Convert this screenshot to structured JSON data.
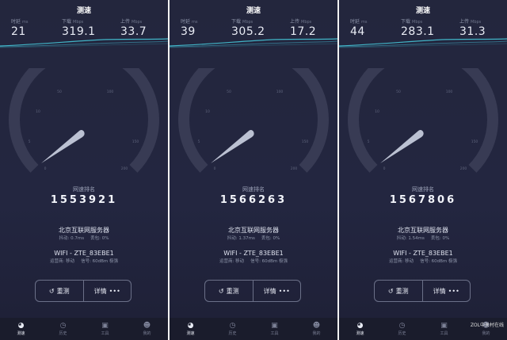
{
  "panels": [
    {
      "title": "测速",
      "metrics": [
        {
          "label": "时延",
          "unit": "ms",
          "value": "21"
        },
        {
          "label": "下载",
          "unit": "Mbps",
          "value": "319.1"
        },
        {
          "label": "上传",
          "unit": "Mbps",
          "value": "33.7"
        }
      ],
      "rank_label": "网速排名",
      "rank_value": "1553921",
      "server": "北京互联网服务器",
      "jitter": "抖动: 0.7ms",
      "loss": "丢包: 0%",
      "wifi": "WIFI - ZTE_83EBE1",
      "operator": "运营商: 移动",
      "signal": "信号: 60dBm 极强",
      "retest_label": "重测",
      "details_label": "详情",
      "tabs": [
        "测速",
        "历史",
        "工具",
        "我的"
      ]
    },
    {
      "title": "测速",
      "metrics": [
        {
          "label": "时延",
          "unit": "ms",
          "value": "39"
        },
        {
          "label": "下载",
          "unit": "Mbps",
          "value": "305.2"
        },
        {
          "label": "上传",
          "unit": "Mbps",
          "value": "17.2"
        }
      ],
      "rank_label": "网速排名",
      "rank_value": "1566263",
      "server": "北京互联网服务器",
      "jitter": "抖动: 1.37ms",
      "loss": "丢包: 0%",
      "wifi": "WIFI - ZTE_83EBE1",
      "operator": "运营商: 移动",
      "signal": "信号: 60dBm 极强",
      "retest_label": "重测",
      "details_label": "详情",
      "tabs": [
        "测速",
        "历史",
        "工具",
        "我的"
      ]
    },
    {
      "title": "测速",
      "metrics": [
        {
          "label": "时延",
          "unit": "ms",
          "value": "44"
        },
        {
          "label": "下载",
          "unit": "Mbps",
          "value": "283.1"
        },
        {
          "label": "上传",
          "unit": "Mbps",
          "value": "31.3"
        }
      ],
      "rank_label": "网速排名",
      "rank_value": "1567806",
      "server": "北京互联网服务器",
      "jitter": "抖动: 1.54ms",
      "loss": "丢包: 0%",
      "wifi": "WIFI - ZTE_83EBE1",
      "operator": "运营商: 移动",
      "signal": "信号: 60dBm 极强",
      "retest_label": "重测",
      "details_label": "详情",
      "tabs": [
        "测速",
        "历史",
        "工具",
        "我的"
      ]
    }
  ],
  "gauge_ticks": [
    "0",
    "5",
    "10",
    "50",
    "100",
    "150",
    "200"
  ],
  "watermark": "ZOL中关村在线",
  "colors": {
    "accent": "#45c4d6",
    "background": "#23263d"
  },
  "icons": {
    "retest": "refresh-icon",
    "details": "more-dots-icon",
    "tabs": [
      "speedometer-icon",
      "clock-icon",
      "toolbox-icon",
      "user-icon"
    ]
  }
}
